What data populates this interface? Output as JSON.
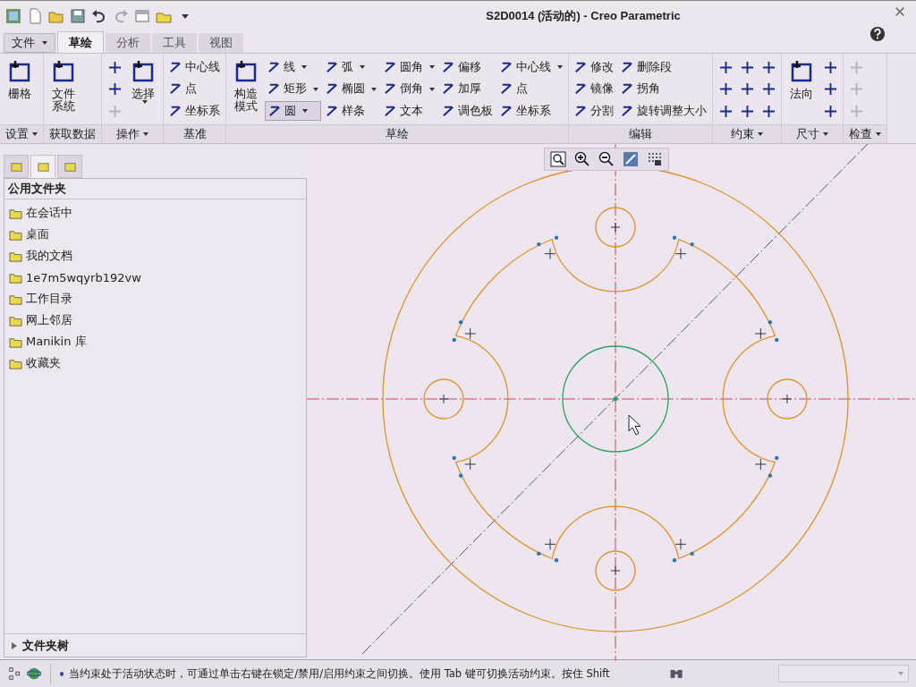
{
  "window": {
    "title": "S2D0014 (活动的) - Creo Parametric"
  },
  "file_menu": {
    "label": "文件"
  },
  "tabs": [
    {
      "label": "草绘",
      "selected": true
    },
    {
      "label": "分析",
      "selected": false
    },
    {
      "label": "工具",
      "selected": false
    },
    {
      "label": "视图",
      "selected": false
    }
  ],
  "ribbon_groups": [
    {
      "label": "设置",
      "dropdown": true,
      "columns": [
        [
          {
            "kind": "large",
            "label": "栅格",
            "dropdown": false
          }
        ]
      ]
    },
    {
      "label": "获取数据",
      "dropdown": false,
      "columns": [
        [
          {
            "kind": "large",
            "label": "文件系统",
            "dropdown": false
          }
        ]
      ]
    },
    {
      "label": "操作",
      "dropdown": true,
      "columns": [
        [
          {
            "kind": "icon",
            "disabled": false
          },
          {
            "kind": "icon",
            "disabled": false
          },
          {
            "kind": "icon",
            "disabled": true
          }
        ],
        [
          {
            "kind": "large",
            "label": "选择",
            "dropdown": true
          }
        ]
      ]
    },
    {
      "label": "基准",
      "dropdown": false,
      "columns": [
        [
          {
            "kind": "small",
            "label": "中心线",
            "dropdown": false,
            "selected": false
          },
          {
            "kind": "small",
            "label": "点",
            "dropdown": false,
            "selected": false
          },
          {
            "kind": "small",
            "label": "坐标系",
            "dropdown": false,
            "selected": false
          }
        ]
      ]
    },
    {
      "label": "草绘",
      "dropdown": false,
      "columns": [
        [
          {
            "kind": "large",
            "label": "构造模式",
            "dropdown": false
          }
        ],
        [
          {
            "kind": "small",
            "label": "线",
            "dropdown": true,
            "selected": false
          },
          {
            "kind": "small",
            "label": "矩形",
            "dropdown": true,
            "selected": false
          },
          {
            "kind": "small",
            "label": "圆",
            "dropdown": true,
            "selected": true
          }
        ],
        [
          {
            "kind": "small",
            "label": "弧",
            "dropdown": true,
            "selected": false
          },
          {
            "kind": "small",
            "label": "椭圆",
            "dropdown": true,
            "selected": false
          },
          {
            "kind": "small",
            "label": "样条",
            "dropdown": false,
            "selected": false
          }
        ],
        [
          {
            "kind": "small",
            "label": "圆角",
            "dropdown": true,
            "selected": false
          },
          {
            "kind": "small",
            "label": "倒角",
            "dropdown": true,
            "selected": false
          },
          {
            "kind": "small",
            "label": "文本",
            "dropdown": false,
            "selected": false
          }
        ],
        [
          {
            "kind": "small",
            "label": "偏移",
            "dropdown": false,
            "selected": false
          },
          {
            "kind": "small",
            "label": "加厚",
            "dropdown": false,
            "selected": false
          },
          {
            "kind": "small",
            "label": "调色板",
            "dropdown": false,
            "selected": false
          }
        ],
        [
          {
            "kind": "small",
            "label": "中心线",
            "dropdown": true,
            "selected": false
          },
          {
            "kind": "small",
            "label": "点",
            "dropdown": false,
            "selected": false
          },
          {
            "kind": "small",
            "label": "坐标系",
            "dropdown": false,
            "selected": false
          }
        ]
      ]
    },
    {
      "label": "编辑",
      "dropdown": false,
      "columns": [
        [
          {
            "kind": "small",
            "label": "修改",
            "dropdown": false,
            "selected": false
          },
          {
            "kind": "small",
            "label": "镜像",
            "dropdown": false,
            "selected": false
          },
          {
            "kind": "small",
            "label": "分割",
            "dropdown": false,
            "selected": false
          }
        ],
        [
          {
            "kind": "small",
            "label": "删除段",
            "dropdown": false,
            "selected": false
          },
          {
            "kind": "small",
            "label": "拐角",
            "dropdown": false,
            "selected": false
          },
          {
            "kind": "small",
            "label": "旋转调整大小",
            "dropdown": false,
            "selected": false
          }
        ]
      ]
    },
    {
      "label": "约束",
      "dropdown": true,
      "columns": [
        [
          {
            "kind": "icon",
            "disabled": false
          },
          {
            "kind": "icon",
            "disabled": false
          },
          {
            "kind": "icon",
            "disabled": false
          }
        ],
        [
          {
            "kind": "icon",
            "disabled": false
          },
          {
            "kind": "icon",
            "disabled": false
          },
          {
            "kind": "icon",
            "disabled": false
          }
        ],
        [
          {
            "kind": "icon",
            "disabled": false
          },
          {
            "kind": "icon",
            "disabled": false
          },
          {
            "kind": "icon",
            "disabled": false
          }
        ]
      ]
    },
    {
      "label": "尺寸",
      "dropdown": true,
      "columns": [
        [
          {
            "kind": "large",
            "label": "法向",
            "dropdown": false
          }
        ],
        [
          {
            "kind": "icon",
            "disabled": false
          },
          {
            "kind": "icon",
            "disabled": false
          },
          {
            "kind": "icon",
            "disabled": false
          }
        ]
      ]
    },
    {
      "label": "检查",
      "dropdown": true,
      "columns": [
        [
          {
            "kind": "icon",
            "disabled": true
          },
          {
            "kind": "icon",
            "disabled": true
          },
          {
            "kind": "icon",
            "disabled": true
          }
        ]
      ]
    }
  ],
  "sidebar": {
    "tabs": [
      {
        "selected": false
      },
      {
        "selected": true
      },
      {
        "selected": false
      }
    ],
    "header": "公用文件夹",
    "items": [
      {
        "label": "在会话中"
      },
      {
        "label": "桌面"
      },
      {
        "label": "我的文档"
      },
      {
        "label": "1e7m5wqyrb192vw"
      },
      {
        "label": "工作目录"
      },
      {
        "label": "网上邻居"
      },
      {
        "label": "Manikin 库"
      },
      {
        "label": "收藏夹"
      }
    ],
    "folder_tree": {
      "label": "文件夹树",
      "expanded": false
    }
  },
  "status_bar": {
    "message": "当约束处于活动状态时，可通过单击右键在锁定/禁用/启用约束之间切换。使用 Tab 键可切换活动约束。按住 Shift"
  }
}
